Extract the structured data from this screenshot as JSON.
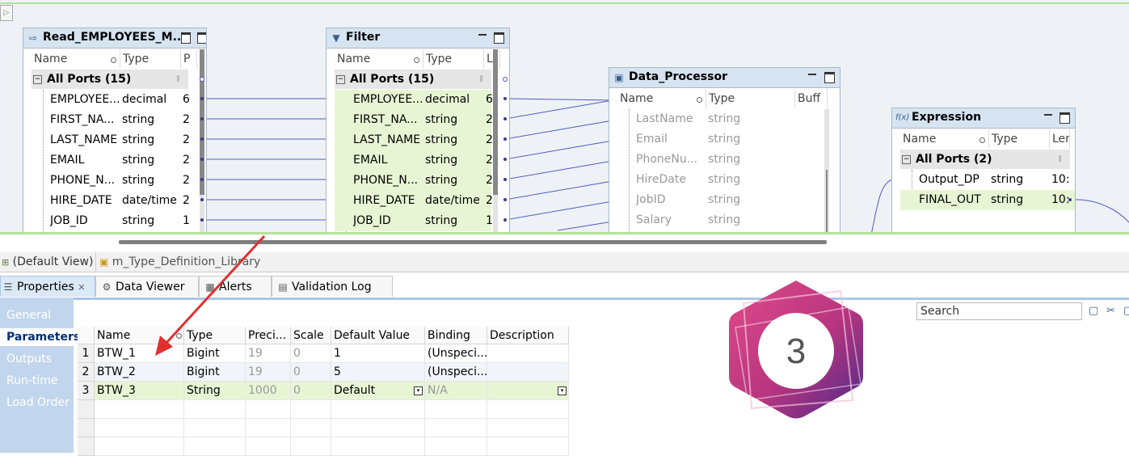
{
  "read_tx": {
    "title": "Read_EMPLOYEES_M...",
    "col_name": "Name",
    "col_type": "Type",
    "col_third": "P",
    "all_ports": "All Ports (15)",
    "ports": [
      {
        "name": "EMPLOYEE...",
        "type": "decimal",
        "extra": "6"
      },
      {
        "name": "FIRST_NA...",
        "type": "string",
        "extra": "2"
      },
      {
        "name": "LAST_NAME",
        "type": "string",
        "extra": "2"
      },
      {
        "name": "EMAIL",
        "type": "string",
        "extra": "2"
      },
      {
        "name": "PHONE_N...",
        "type": "string",
        "extra": "2"
      },
      {
        "name": "HIRE_DATE",
        "type": "date/time",
        "extra": "2"
      },
      {
        "name": "JOB_ID",
        "type": "string",
        "extra": "1"
      }
    ]
  },
  "filter_tx": {
    "title": "Filter",
    "col_name": "Name",
    "col_type": "Type",
    "col_third": "L",
    "all_ports": "All Ports (15)",
    "ports": [
      {
        "name": "EMPLOYEE...",
        "type": "decimal",
        "extra": "6"
      },
      {
        "name": "FIRST_NA...",
        "type": "string",
        "extra": "2"
      },
      {
        "name": "LAST_NAME",
        "type": "string",
        "extra": "2"
      },
      {
        "name": "EMAIL",
        "type": "string",
        "extra": "2"
      },
      {
        "name": "PHONE_N...",
        "type": "string",
        "extra": "2"
      },
      {
        "name": "HIRE_DATE",
        "type": "date/time",
        "extra": "2"
      },
      {
        "name": "JOB_ID",
        "type": "string",
        "extra": "1"
      }
    ]
  },
  "dp_tx": {
    "title": "Data_Processor",
    "col_name": "Name",
    "col_type": "Type",
    "col_third": "Buff",
    "ports": [
      {
        "name": "LastName",
        "type": "string"
      },
      {
        "name": "Email",
        "type": "string"
      },
      {
        "name": "PhoneNu...",
        "type": "string"
      },
      {
        "name": "HireDate",
        "type": "string"
      },
      {
        "name": "JobID",
        "type": "string"
      },
      {
        "name": "Salary",
        "type": "string"
      }
    ]
  },
  "expr_tx": {
    "title": "Expression",
    "col_name": "Name",
    "col_type": "Type",
    "col_third": "Ler",
    "all_ports": "All Ports (2)",
    "ports": [
      {
        "name": "Output_DP",
        "type": "string",
        "extra": "10:"
      },
      {
        "name": "FINAL_OUT",
        "type": "string",
        "extra": "10:"
      }
    ]
  },
  "editor_tabs": {
    "default_view": "(Default View)",
    "library": "m_Type_Definition_Library"
  },
  "view_tabs": {
    "properties": "Properties",
    "data_viewer": "Data Viewer",
    "alerts": "Alerts",
    "validation_log": "Validation Log"
  },
  "sidebar": {
    "items": [
      "General",
      "Parameters",
      "Outputs",
      "Run-time",
      "Load Order"
    ]
  },
  "search": {
    "placeholder": "Search"
  },
  "param_table": {
    "headers": [
      "Name",
      "Type",
      "Preci...",
      "Scale",
      "Default Value",
      "Binding",
      "Description"
    ],
    "rows": [
      {
        "num": "1",
        "name": "BTW_1",
        "type": "Bigint",
        "precision": "19",
        "scale": "0",
        "default": "1",
        "binding": "(Unspeci...",
        "description": ""
      },
      {
        "num": "2",
        "name": "BTW_2",
        "type": "Bigint",
        "precision": "19",
        "scale": "0",
        "default": "5",
        "binding": "(Unspeci...",
        "description": ""
      },
      {
        "num": "3",
        "name": "BTW_3",
        "type": "String",
        "precision": "1000",
        "scale": "0",
        "default": "Default",
        "binding": "N/A",
        "description": ""
      }
    ]
  },
  "badge": {
    "number": "3"
  },
  "colors": {
    "accent": "#a9c6e8",
    "highlight": "#e8f5d4",
    "arrow": "#e03030",
    "badge_pink": "#d63a7a",
    "badge_purple": "#5a2a9a"
  }
}
